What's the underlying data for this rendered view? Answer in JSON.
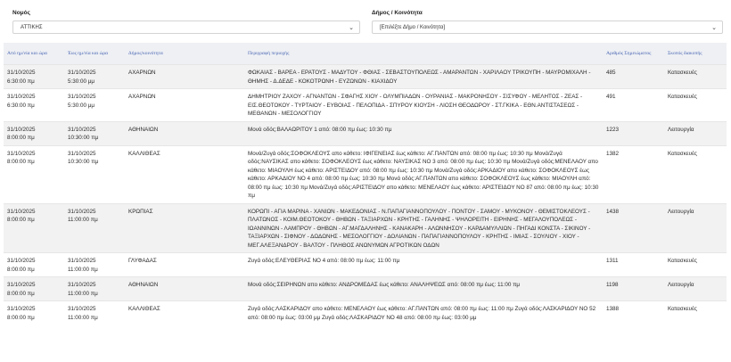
{
  "filters": {
    "prefecture_label": "Νομός",
    "prefecture_value": "ΑΤΤΙΚΗΣ",
    "municipality_label": "Δήμος / Κοινότητα",
    "municipality_placeholder": "[Επιλέξτε Δήμο / Κοινότητα]"
  },
  "table": {
    "headers": {
      "from": "Από ημ/νία και ώρα",
      "to": "Έως ημ/νία και ώρα",
      "municipality": "Δήμος/κοινότητα",
      "area": "Περιγραφή περιοχής",
      "notice": "Αριθμός Σημειώματος",
      "purpose": "Σκοπός διακοπής"
    },
    "rows": [
      {
        "from_date": "31/10/2025",
        "from_time": "6:30:00 πμ",
        "to_date": "31/10/2025",
        "to_time": "5:30:00 μμ",
        "municipality": "ΑΧΑΡΝΩΝ",
        "area": "ΦΩΚΑΙΑΣ - ΒΑΡΕΑ - ΕΡΑΤΟΥΣ - ΜΑΔΥΤΟΥ - ΦΘΙΑΣ - ΣΕΒΑΣΤΟΥΠΟΛΕΩΣ - ΑΜΑΡΑΝΤΩΝ - ΧΑΡΙΛΑΟΥ ΤΡΙΚΟΥΠΗ - ΜΑΥΡΟΜΙΧΑΛΗ - ΘΗΜΗΣ - Δ.ΔΕΔΕ - ΚΟΚΟΤΡΩΝΗ - ΕΥΖΩΝΩΝ - ΚΙΑΧΙΔΟΥ",
        "notice": "485",
        "purpose": "Κατασκευές"
      },
      {
        "from_date": "31/10/2025",
        "from_time": "6:30:00 πμ",
        "to_date": "31/10/2025",
        "to_time": "5:30:00 μμ",
        "municipality": "ΑΧΑΡΝΩΝ",
        "area": "ΔΗΜΗΤΡΙΟΥ ΖΑΧΟΥ - ΑΓΝΑΝΤΩΝ - ΣΦΑΓΗΣ ΧΙΟΥ - ΟΛΥΜΠΙΑΔΩΝ - ΟΥΡΑΝΙΑΣ - ΜΑΚΡΟΝΗΣΟΥ - ΣΙΣΥΦΟΥ - ΜΕΛΗΤΟΣ - ΖΕΑΣ - ΕΙΣ.ΘΕΟΤΟΚΟΥ - ΤΥΡΤΑΙΟΥ - ΕΥΒΟΙΑΣ - ΠΕΛΟΠΙΔΑ - ΣΠΥΡΟΥ ΚΙΟΥΣΗ - ΛΙΟΣΗ ΘΕΟΔΩΡΟΥ - ΣΤ.ΓΚΙΚΑ - ΕΘΝ.ΑΝΤΙΣΤΑΣΕΩΣ - ΜΕΘΑΝΩΝ - ΜΕΣΟΛΟΓΓΙΟΥ",
        "notice": "491",
        "purpose": "Κατασκευές"
      },
      {
        "from_date": "31/10/2025",
        "from_time": "8:00:00 πμ",
        "to_date": "31/10/2025",
        "to_time": "10:30:00 πμ",
        "municipality": "ΑΘΗΝΑΙΩΝ",
        "area": "Μονά οδός:ΒΑΛΑΩΡΙΤΟΥ 1 από: 08:00 πμ έως: 10:30 πμ",
        "notice": "1223",
        "purpose": "Λειτουργία"
      },
      {
        "from_date": "31/10/2025",
        "from_time": "8:00:00 πμ",
        "to_date": "31/10/2025",
        "to_time": "10:30:00 πμ",
        "municipality": "ΚΑΛΛΙΘΕΑΣ",
        "area": "Μονά/Ζυγά οδός:ΣΟΦΟΚΛΕΟΥΣ απο κάθετο: ΙΦΙΓΕΝΕΙΑΣ έως κάθετο: ΑΓ.ΠΑΝΤΩΝ από: 08:00 πμ έως: 10:30 πμ Μονά/Ζυγά οδός:ΝΑΥΣΙΚΑΣ απο κάθετο: ΣΟΦΟΚΛΕΟΥΣ έως κάθετο: ΝΑΥΣΙΚΑΣ ΝΟ 3 από: 08:00 πμ έως: 10:30 πμ Μονά/Ζυγά οδός:ΜΕΝΕΛΑΟΥ απο κάθετο: ΜΙΑΟΥΛΗ έως κάθετο: ΑΡΙΣΤΕΙΔΟΥ από: 08:00 πμ έως: 10:30 πμ Μονά/Ζυγά οδός:ΑΡΚΑΔΙΟΥ απο κάθετο: ΣΟΦΟΚΛΕΟΥΣ έως κάθετο: ΑΡΚΑΔΙΟΥ ΝΟ 4 από: 08:00 πμ έως: 10:30 πμ Μονά οδός:ΑΓ.ΠΑΝΤΩΝ απο κάθετο: ΣΟΦΟΚΛΕΟΥΣ έως κάθετο: ΜΙΑΟΥΛΗ από: 08:00 πμ έως: 10:30 πμ Μονά/Ζυγά οδός:ΑΡΙΣΤΕΙΔΟΥ απο κάθετο: ΜΕΝΕΛΑΟΥ έως κάθετο: ΑΡΙΣΤΕΙΔΟΥ ΝΟ 87 από: 08:00 πμ έως: 10:30 πμ",
        "notice": "1382",
        "purpose": "Κατασκευές"
      },
      {
        "from_date": "31/10/2025",
        "from_time": "8:00:00 πμ",
        "to_date": "31/10/2025",
        "to_time": "11:00:00 πμ",
        "municipality": "ΚΡΩΠΙΑΣ",
        "area": "ΚΟΡΩΠΙ - ΑΓΙΑ ΜΑΡΙΝΑ - ΧΑΝΙΩΝ - ΜΑΚΕΔΟΝΙΑΣ - Ν.ΠΑΠΑΓΙΑΝΝΟΠΟΥΛΟΥ - ΠΟΝΤΟΥ - ΣΑΜΟΥ - ΜΥΚΟΝΟΥ - ΘΕΜΙΣΤΟΚΛΕΟΥΣ - ΠΛΑΤΩΝΟΣ - ΚΟΙΜ.ΘΕΟΤΟΚΟΥ - ΘΗΒΩΝ - ΤΑΞΙΑΡΧΩΝ - ΚΡΗΤΗΣ - ΓΑΛΗΝΗΣ - ΨΗΛΟΡΕΙΤΗ - ΕΙΡΗΝΗΣ - ΜΕΓΑΛΟΥΠΟΛΕΩΣ - ΙΩΑΝΝΙΝΩΝ - ΛΑΜΠΡΟΥ - ΘΗΒΩΝ - ΑΓ.ΜΑΓΔΑΛΗΝΗΣ - ΚΑΝΑΚΑΡΗ - ΑΛΩΝΝΗΣΟΥ - ΚΑΡΔΑΜΥΛΛΙΩΝ - ΠΗΓΑΔΙ ΚΟΝΣΤΑ - ΣΙΚΙΝΟΥ - ΤΑΞΙΑΡΧΩΝ - ΣΙΦΝΟΥ - ΔΩΔΩΝΗΣ - ΜΕΣΟΛΟΓΓΙΟΥ - ΔΟΛΙΑΝΩΝ - ΠΑΠΑΓΙΑΝΝΟΠΟΥΛΟΥ - ΚΡΗΤΗΣ - ΙΜΙΑΣ - ΣΟΥΛΙΟΥ - ΧΙΟΥ - ΜΕΓ.ΑΛΕΞΑΝΔΡΟΥ - ΒΑΛΤΟΥ - ΠΛΗΘΟΣ ΑΝΩΝΥΜΩΝ ΑΓΡΟΤΙΚΩΝ ΟΔΩΝ",
        "notice": "1438",
        "purpose": "Λειτουργία"
      },
      {
        "from_date": "31/10/2025",
        "from_time": "8:00:00 πμ",
        "to_date": "31/10/2025",
        "to_time": "11:00:00 πμ",
        "municipality": "ΓΛΥΦΑΔΑΣ",
        "area": "Ζυγά οδός:ΕΛΕΥΘΕΡΙΑΣ ΝΟ 4 από: 08:00 πμ έως: 11:00 πμ",
        "notice": "1311",
        "purpose": "Κατασκευές"
      },
      {
        "from_date": "31/10/2025",
        "from_time": "8:00:00 πμ",
        "to_date": "31/10/2025",
        "to_time": "11:00:00 πμ",
        "municipality": "ΑΘΗΝΑΙΩΝ",
        "area": "Μονά οδός:ΣΕΙΡΗΝΩΝ απο κάθετο: ΑΝΔΡΟΜΕΔΑΣ έως κάθετο: ΑΝΑΛΗΨΕΩΣ από: 08:00 πμ έως: 11:00 πμ",
        "notice": "1198",
        "purpose": "Λειτουργία"
      },
      {
        "from_date": "31/10/2025",
        "from_time": "8:00:00 πμ",
        "to_date": "31/10/2025",
        "to_time": "11:00:00 πμ",
        "municipality": "ΚΑΛΛΙΘΕΑΣ",
        "area": "Ζυγά οδός:ΛΑΣΚΑΡΙΔΟΥ απο κάθετο: ΜΕΝΕΛΑΟΥ έως κάθετο: ΑΓ.ΠΑΝΤΩΝ από: 08:00 πμ έως: 11:00 πμ Ζυγά οδός:ΛΑΣΚΑΡΙΔΟΥ ΝΟ 52 από: 08:00 πμ έως: 03:00 μμ Ζυγά οδός:ΛΑΣΚΑΡΙΔΟΥ ΝΟ 48 από: 08:00 πμ έως: 03:00 μμ",
        "notice": "1388",
        "purpose": "Κατασκευές"
      }
    ]
  }
}
